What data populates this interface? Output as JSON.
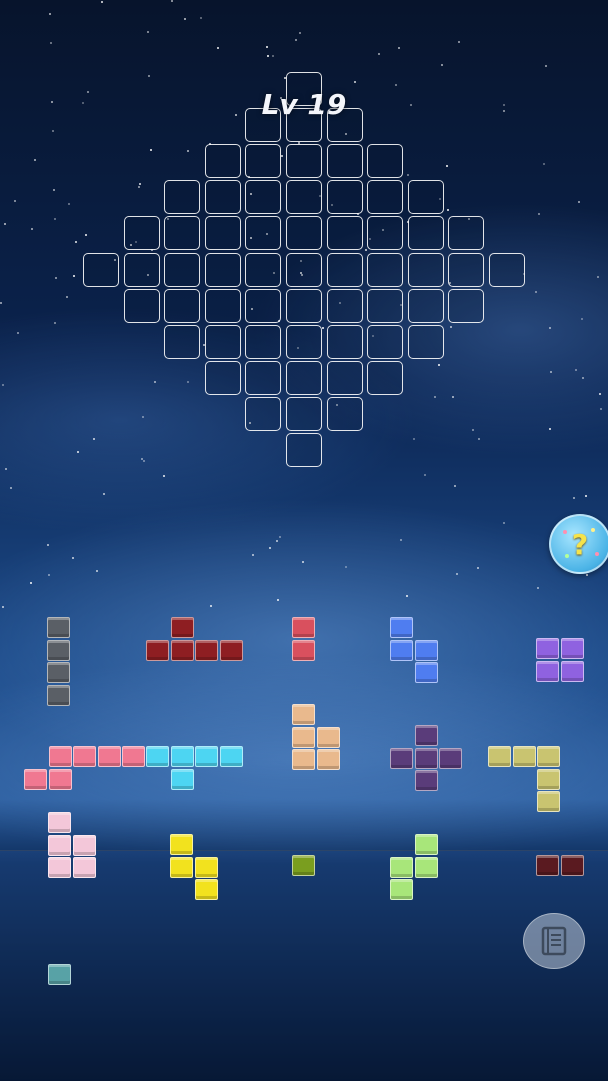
{
  "level": {
    "label": "Lv 19"
  },
  "hint_button": {
    "icon": "question-mark-icon",
    "glyph": "?"
  },
  "book_button": {
    "icon": "book-icon"
  },
  "colors": {
    "cell_border": "#ffffff",
    "gray": "#5a5f66",
    "dark_red": "#8e1e22",
    "rose_red": "#d9505e",
    "blue": "#4f7df0",
    "purple": "#8f62e0",
    "pink": "#f07891",
    "cyan": "#4dd5f2",
    "peach": "#e9b98d",
    "dark_purple": "#5a3c7a",
    "khaki": "#c9c470",
    "light_pink": "#f3c7d9",
    "yellow": "#f2e21e",
    "olive_green": "#7a9e1f",
    "lime": "#a8e67a",
    "maroon": "#5a1a20",
    "teal": "#58a2a6"
  },
  "pieces": [
    {
      "name": "gray-i-piece",
      "color": "#5a5f66"
    },
    {
      "name": "dark-red-j-piece",
      "color": "#8e1e22"
    },
    {
      "name": "rose-domino-piece",
      "color": "#d9505e"
    },
    {
      "name": "blue-s-piece",
      "color": "#4f7df0"
    },
    {
      "name": "purple-square-piece",
      "color": "#8f62e0"
    },
    {
      "name": "pink-z-piece",
      "color": "#f07891"
    },
    {
      "name": "cyan-l-piece",
      "color": "#4dd5f2"
    },
    {
      "name": "peach-p-piece",
      "color": "#e9b98d"
    },
    {
      "name": "dark-purple-plus-piece",
      "color": "#5a3c7a"
    },
    {
      "name": "khaki-corner-piece",
      "color": "#c9c470"
    },
    {
      "name": "light-pink-p-piece",
      "color": "#f3c7d9"
    },
    {
      "name": "yellow-s-piece",
      "color": "#f2e21e"
    },
    {
      "name": "olive-mono-piece",
      "color": "#7a9e1f"
    },
    {
      "name": "lime-z-piece",
      "color": "#a8e67a"
    },
    {
      "name": "maroon-domino-piece",
      "color": "#5a1a20"
    },
    {
      "name": "teal-mono-piece",
      "color": "#58a2a6"
    }
  ]
}
